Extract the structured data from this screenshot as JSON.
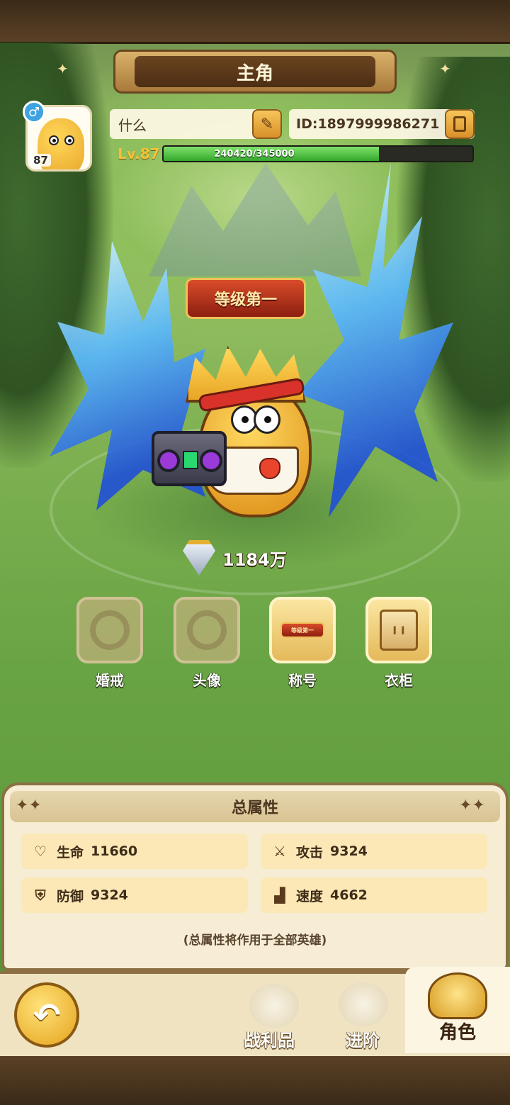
{
  "header": {
    "title": "主角"
  },
  "player": {
    "gender_icon": "♂",
    "avatar_level": "87",
    "name": "什么",
    "id_text": "ID:1897999986271",
    "level_label": "Lv.87",
    "exp_text": "240420/345000",
    "exp_progress": 0.6969
  },
  "hero": {
    "title_badge": "等级第一",
    "power": "1184万"
  },
  "slots": [
    {
      "label": "婚戒"
    },
    {
      "label": "头像"
    },
    {
      "label": "称号",
      "badge": "等级第一"
    },
    {
      "label": "衣柜",
      "book": "I I"
    }
  ],
  "attributes": {
    "heading": "总属性",
    "items": [
      {
        "name": "生命",
        "value": "11660",
        "icon": "heart-icon",
        "glyph": "♡"
      },
      {
        "name": "攻击",
        "value": "9324",
        "icon": "sword-icon",
        "glyph": "⚔"
      },
      {
        "name": "防御",
        "value": "9324",
        "icon": "shield-icon",
        "glyph": "⛨"
      },
      {
        "name": "速度",
        "value": "4662",
        "icon": "boot-icon",
        "glyph": "▟"
      }
    ],
    "note": "(总属性将作用于全部英雄)"
  },
  "nav": {
    "back_glyph": "↶",
    "items": [
      {
        "label": "战利品"
      },
      {
        "label": "进阶"
      },
      {
        "label": "角色"
      }
    ]
  },
  "colors": {
    "exp_fill": "#34a82c",
    "accent_gold": "#e5a31c",
    "panel_bg": "#f6edd4"
  }
}
